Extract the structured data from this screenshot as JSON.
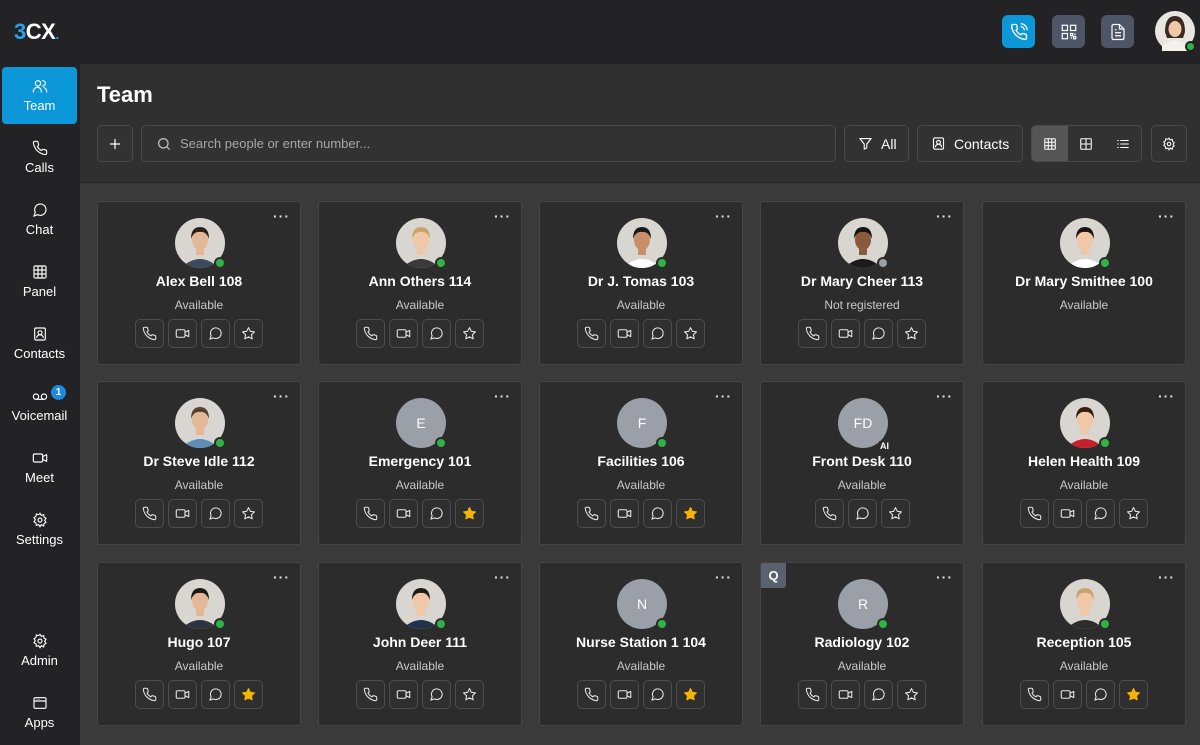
{
  "app": {
    "logo_number": "3",
    "logo_letters": "CX",
    "logo_dot": "."
  },
  "colors": {
    "accent": "#0b97d8",
    "available": "#2fb344",
    "unregistered": "#9a9fa8",
    "favorite": "#f5b400"
  },
  "topbar": {
    "icons": [
      "phone-icon",
      "qr-code-icon",
      "document-icon"
    ]
  },
  "sidebar": {
    "items": [
      {
        "label": "Team",
        "icon": "team-icon"
      },
      {
        "label": "Calls",
        "icon": "phone-icon"
      },
      {
        "label": "Chat",
        "icon": "chat-icon"
      },
      {
        "label": "Panel",
        "icon": "panel-icon"
      },
      {
        "label": "Contacts",
        "icon": "contacts-icon"
      },
      {
        "label": "Voicemail",
        "icon": "voicemail-icon",
        "badge": "1"
      },
      {
        "label": "Meet",
        "icon": "video-icon"
      },
      {
        "label": "Settings",
        "icon": "gear-icon"
      },
      {
        "label": "Admin",
        "icon": "admin-gear-icon"
      },
      {
        "label": "Apps",
        "icon": "apps-icon"
      }
    ]
  },
  "main": {
    "title": "Team",
    "search_placeholder": "Search people or enter number...",
    "filter_label": "All",
    "contacts_label": "Contacts",
    "more_label": "···",
    "cards": [
      {
        "name": "Alex Bell 108",
        "status": "Available",
        "presence": "available",
        "fav": false,
        "actions": 4
      },
      {
        "name": "Ann Others 114",
        "status": "Available",
        "presence": "available",
        "fav": false,
        "actions": 4
      },
      {
        "name": "Dr J. Tomas 103",
        "status": "Available",
        "presence": "available",
        "fav": false,
        "actions": 4
      },
      {
        "name": "Dr Mary Cheer 113",
        "status": "Not registered",
        "presence": "unregistered",
        "fav": false,
        "actions": 4
      },
      {
        "name": "Dr Mary Smithee 100",
        "status": "Available",
        "presence": "available",
        "fav": false,
        "actions": 0
      },
      {
        "name": "Dr Steve Idle 112",
        "status": "Available",
        "presence": "available",
        "fav": false,
        "actions": 4
      },
      {
        "name": "Emergency 101",
        "status": "Available",
        "presence": "available",
        "fav": true,
        "initials": "E",
        "actions": 4
      },
      {
        "name": "Facilities 106",
        "status": "Available",
        "presence": "available",
        "fav": true,
        "initials": "F",
        "actions": 4
      },
      {
        "name": "Front Desk 110",
        "status": "Available",
        "presence": "ai",
        "fav": false,
        "initials": "FD",
        "ai": "AI",
        "actions": 3
      },
      {
        "name": "Helen Health 109",
        "status": "Available",
        "presence": "available",
        "fav": false,
        "actions": 4
      },
      {
        "name": "Hugo 107",
        "status": "Available",
        "presence": "available",
        "fav": true,
        "actions": 4
      },
      {
        "name": "John Deer 111",
        "status": "Available",
        "presence": "available",
        "fav": false,
        "actions": 4
      },
      {
        "name": "Nurse Station 1 104",
        "status": "Available",
        "presence": "available",
        "fav": true,
        "initials": "N",
        "actions": 4
      },
      {
        "name": "Radiology 102",
        "status": "Available",
        "presence": "available",
        "fav": false,
        "initials": "R",
        "queue": "Q",
        "actions": 4
      },
      {
        "name": "Reception 105",
        "status": "Available",
        "presence": "available",
        "fav": true,
        "actions": 4
      }
    ]
  }
}
